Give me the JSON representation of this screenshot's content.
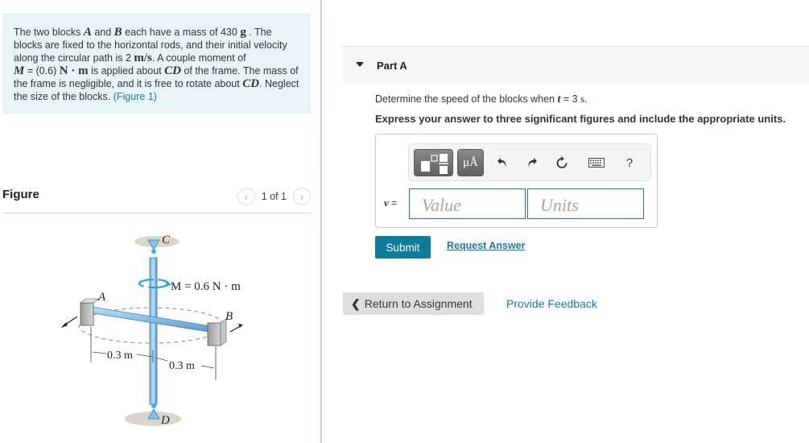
{
  "problem": {
    "t1": "The two blocks ",
    "A": "A",
    "t2": " and ",
    "B": "B",
    "t3": " each have a mass of 430 ",
    "mass_unit": "g",
    "t4": " . The blocks are fixed to the horizontal rods, and their initial velocity along the circular path is 2 ",
    "vel_unit": "m/s",
    "t5": ". A couple moment of ",
    "M": "M",
    "t6": " = (0.6) ",
    "moment_unit": "N · m",
    "t7": " is applied about ",
    "CD": "CD",
    "t8": " of the frame. The mass of the frame is negligible, and it is free to rotate about ",
    "CD2": "CD",
    "t9": ". Neglect the size of the blocks. ",
    "figure_link": "(Figure 1)"
  },
  "figure_panel": {
    "title": "Figure",
    "prev_icon": "‹",
    "next_icon": "›",
    "page_count": "1 of 1",
    "labels": {
      "C": "C",
      "D": "D",
      "A": "A",
      "B": "B",
      "moment": "M = 0.6 N · m",
      "dim_left": "0.3 m",
      "dim_right": "0.3 m"
    }
  },
  "part": {
    "title": "Part A",
    "question_pre": "Determine the speed of the blocks when ",
    "question_var": "t",
    "question_post": " = 3 ",
    "question_unit": "s",
    "question_end": ".",
    "instruction": "Express your answer to three significant figures and include the appropriate units."
  },
  "answer": {
    "toolbar": {
      "units_label": "μÅ",
      "undo_icon": "↶",
      "redo_icon": "↷",
      "reset_icon": "↻",
      "help_label": "?"
    },
    "variable": "v",
    "equals": " =",
    "value_placeholder": "Value",
    "units_placeholder": "Units"
  },
  "actions": {
    "submit": "Submit",
    "request_answer": "Request Answer",
    "return_chevron": "❮",
    "return_label": "Return to Assignment",
    "feedback": "Provide Feedback"
  }
}
